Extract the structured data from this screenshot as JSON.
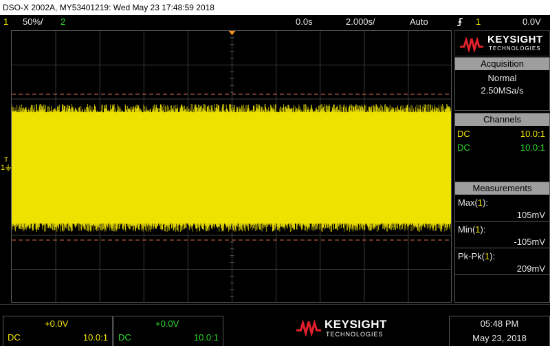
{
  "title_bar": "DSO-X 2002A, MY53401219: Wed May 23 17:48:59 2018",
  "status": {
    "ch1_number": "1",
    "ch1_scale": "50%/",
    "ch2_number": "2",
    "time_offset": "0.0s",
    "time_scale": "2.000s/",
    "trigger_mode": "Auto",
    "trigger_edge_icon": "rising-edge-icon",
    "trigger_source": "1",
    "trigger_level": "0.0V"
  },
  "waveform": {
    "trace_color": "#f2e600",
    "upper_cursor_color": "#e06a4a",
    "lower_cursor_color": "#e06a4a"
  },
  "left_markers": {
    "trigger_marker": "T",
    "ch1_marker": "1"
  },
  "brand": {
    "name": "KEYSIGHT",
    "sub": "TECHNOLOGIES"
  },
  "acquisition": {
    "header": "Acquisition",
    "mode": "Normal",
    "rate": "2.50MSa/s"
  },
  "channels": {
    "header": "Channels",
    "rows": [
      {
        "coupling": "DC",
        "probe": "10.0:1",
        "color": "#f2e600"
      },
      {
        "coupling": "DC",
        "probe": "10.0:1",
        "color": "#2fdc2f"
      }
    ]
  },
  "measurements": {
    "header": "Measurements",
    "items": [
      {
        "label_prefix": "Max(",
        "channel": "1",
        "label_suffix": "):",
        "value": "105mV"
      },
      {
        "label_prefix": "Min(",
        "channel": "1",
        "label_suffix": "):",
        "value": "-105mV"
      },
      {
        "label_prefix": "Pk-Pk(",
        "channel": "1",
        "label_suffix": "):",
        "value": "209mV"
      }
    ]
  },
  "bottom": {
    "ch1": {
      "offset": "+0.0V",
      "coupling": "DC",
      "probe": "10.0:1"
    },
    "ch2": {
      "offset": "+0.0V",
      "coupling": "DC",
      "probe": "10.0:1"
    },
    "brand_name": "KEYSIGHT",
    "brand_sub": "TECHNOLOGIES",
    "time": "05:48 PM",
    "date": "May 23, 2018"
  }
}
